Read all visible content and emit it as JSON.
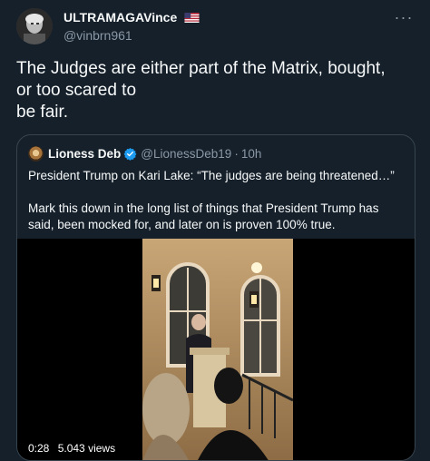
{
  "author": {
    "display_name": "ULTRAMAGAVince",
    "handle": "@vinbrn961",
    "flag_icon": "us-flag-icon"
  },
  "tweet": {
    "text": "The Judges are either part of the Matrix, bought,\nor too scared to\nbe fair."
  },
  "more_label": "···",
  "quoted_tweet": {
    "display_name": "Lioness Deb",
    "verified_icon": "verified-badge-icon",
    "handle": "@LionessDeb19",
    "separator": "·",
    "time": "10h",
    "paragraph1": "President Trump on Kari Lake: “The judges are being threatened…”",
    "paragraph2": "Mark this down in the long list of things that President Trump has said, been mocked for, and later on is proven 100% true."
  },
  "video": {
    "duration": "0:28",
    "views": "5.043 views"
  },
  "colors": {
    "background": "#15202b",
    "text_primary": "#f7f9f9",
    "text_secondary": "#8b98a5",
    "border": "#38444d",
    "verified": "#1d9bf0"
  }
}
